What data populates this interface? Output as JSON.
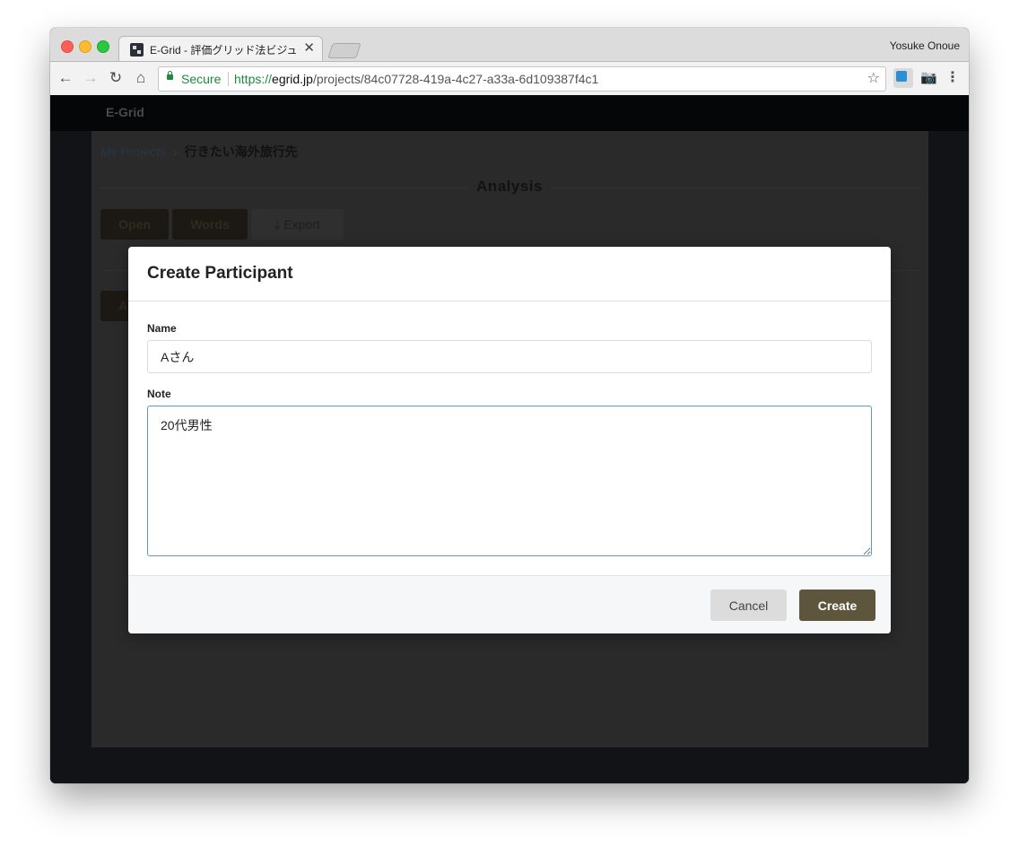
{
  "browser": {
    "tab_title": "E-Grid - 評価グリッド法ビジュ",
    "tab_close": "✕",
    "profile_name": "Yosuke Onoue",
    "secure_label": "Secure",
    "url_scheme": "https://",
    "url_host": "egrid.jp",
    "url_path": "/projects/84c07728-419a-4c27-a33a-6d109387f4c1",
    "icons": {
      "back": "←",
      "forward": "→",
      "reload": "↻",
      "home": "⌂",
      "star": "☆",
      "camera": "📷",
      "menu": "⋮"
    }
  },
  "app": {
    "brand": "E-Grid",
    "breadcrumb": {
      "link": "My Projects",
      "separator": "›",
      "current": "行きたい海外旅行先"
    },
    "section_title": "Analysis",
    "buttons": {
      "open": "Open",
      "words": "Words",
      "export": "Export",
      "export_icon": "⤓",
      "participant_partial": "A"
    }
  },
  "modal": {
    "title": "Create Participant",
    "name_label": "Name",
    "name_value": "Aさん",
    "note_label": "Note",
    "note_value": "20代男性",
    "cancel_label": "Cancel",
    "create_label": "Create"
  },
  "colors": {
    "create_button": "#5d563d",
    "secure_green": "#1d8a3a",
    "textarea_focus": "#5b98c9"
  }
}
